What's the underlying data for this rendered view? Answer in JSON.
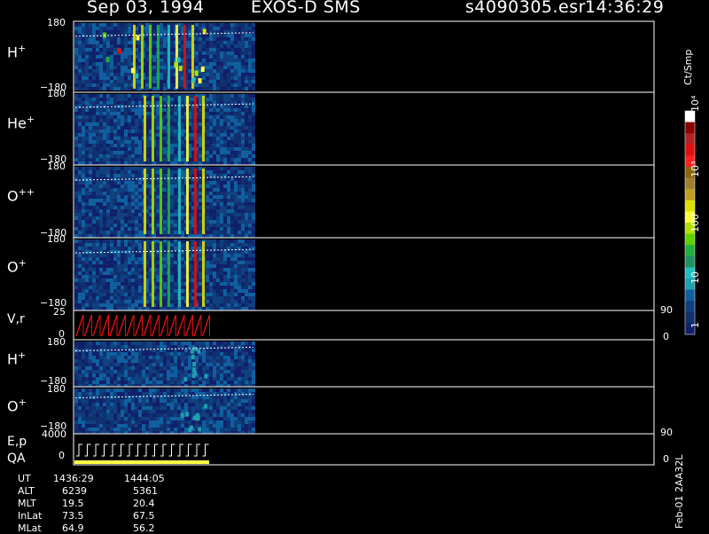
{
  "header": {
    "date": "Sep 03, 1994",
    "instrument": "EXOS-D SMS",
    "file": "s4090305.esr",
    "time": "14:36:29"
  },
  "chart_data": {
    "type": "heatmap",
    "panels": [
      {
        "label": "H",
        "superscript": "+",
        "ytick_top": "180",
        "ytick_bottom": "−180",
        "ylim": [
          -180,
          180
        ],
        "data_end_fraction": 0.31
      },
      {
        "label": "He",
        "superscript": "+",
        "ytick_top": "180",
        "ytick_bottom": "−180",
        "ylim": [
          -180,
          180
        ],
        "data_end_fraction": 0.31
      },
      {
        "label": "O",
        "superscript": "++",
        "ytick_top": "180",
        "ytick_bottom": "−180",
        "ylim": [
          -180,
          180
        ],
        "data_end_fraction": 0.31
      },
      {
        "label": "O",
        "superscript": "+",
        "ytick_top": "180",
        "ytick_bottom": "−180",
        "ylim": [
          -180,
          180
        ],
        "data_end_fraction": 0.31
      },
      {
        "label": "V,r",
        "superscript": "",
        "ytick_top": "25",
        "ytick_bottom": "0",
        "right_tick_top": "90",
        "right_tick_bottom": "0"
      },
      {
        "label": "H",
        "superscript": "+",
        "ytick_top": "180",
        "ytick_bottom": "−180",
        "ylim": [
          -180,
          180
        ],
        "data_end_fraction": 0.31
      },
      {
        "label": "O",
        "superscript": "+",
        "ytick_top": "180",
        "ytick_bottom": "−180",
        "ylim": [
          -180,
          180
        ],
        "data_end_fraction": 0.31
      },
      {
        "label": "E,p",
        "label2": "QA",
        "superscript": "",
        "ytick_top": "4000",
        "ytick_bottom": "0",
        "right_tick_top": "90",
        "right_tick_bottom": "0"
      }
    ],
    "colorbar": {
      "unit": "Ct/Smp",
      "ticks": [
        "10⁴",
        "10³",
        "100",
        "10",
        "1"
      ],
      "colors": [
        "#ffffff",
        "#8b0000",
        "#b22222",
        "#e01010",
        "#ff2020",
        "#8b6508",
        "#a08030",
        "#c0a020",
        "#e0e000",
        "#ffff40",
        "#b0e000",
        "#60d000",
        "#20b040",
        "#209060",
        "#20c0c0",
        "#20a0b0",
        "#1060a0",
        "#10407f",
        "#103070",
        "#10206a"
      ]
    }
  },
  "footer": {
    "labels": [
      "UT",
      "ALT",
      "MLT",
      "InLat",
      "MLat"
    ],
    "col1": [
      "1436:29",
      "6239",
      "19.5",
      "73.5",
      "64.9"
    ],
    "col2": [
      "1444:05",
      "5361",
      "20.4",
      "67.5",
      "56.2"
    ],
    "stamp": "Feb-01 2AA32L"
  }
}
